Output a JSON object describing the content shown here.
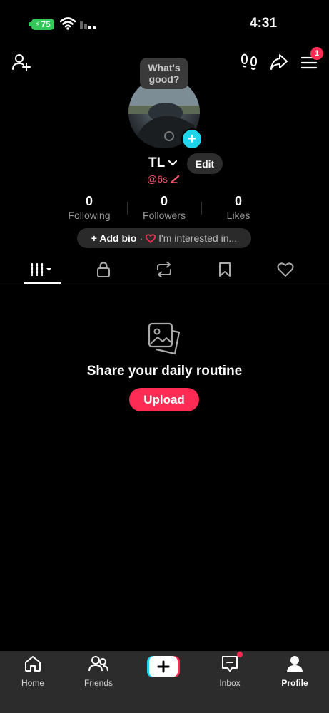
{
  "status_bar": {
    "time": "4:31",
    "battery": "75"
  },
  "header": {
    "add_friend_icon": "person-add-icon",
    "footprints_icon": "footprints-icon",
    "share_icon": "share-icon",
    "menu_icon": "hamburger-menu-icon",
    "menu_badge": "1"
  },
  "profile": {
    "bubble_text": "What's good?",
    "display_name": "TL",
    "edit_label": "Edit",
    "username": "@6s",
    "stats": [
      {
        "value": "0",
        "label": "Following"
      },
      {
        "value": "0",
        "label": "Followers"
      },
      {
        "value": "0",
        "label": "Likes"
      }
    ],
    "add_bio_label": "+ Add bio",
    "separator": "·",
    "interest_label": "I'm interested in..."
  },
  "tabs": [
    {
      "name": "videos",
      "icon": "grid-icon",
      "active": true
    },
    {
      "name": "private",
      "icon": "lock-icon",
      "active": false
    },
    {
      "name": "reposts",
      "icon": "repost-icon",
      "active": false
    },
    {
      "name": "favorites",
      "icon": "bookmark-icon",
      "active": false
    },
    {
      "name": "liked",
      "icon": "heart-icon",
      "active": false
    }
  ],
  "empty_state": {
    "icon": "photos-icon",
    "title": "Share your daily routine",
    "button_label": "Upload"
  },
  "bottom_nav": [
    {
      "label": "Home",
      "icon": "home-icon"
    },
    {
      "label": "Friends",
      "icon": "friends-icon"
    },
    {
      "label": "",
      "icon": "create-plus-icon"
    },
    {
      "label": "Inbox",
      "icon": "inbox-icon"
    },
    {
      "label": "Profile",
      "icon": "profile-icon",
      "active": true
    }
  ],
  "colors": {
    "accent": "#fe2c55",
    "cyan": "#20d5ec",
    "background": "#000000"
  }
}
